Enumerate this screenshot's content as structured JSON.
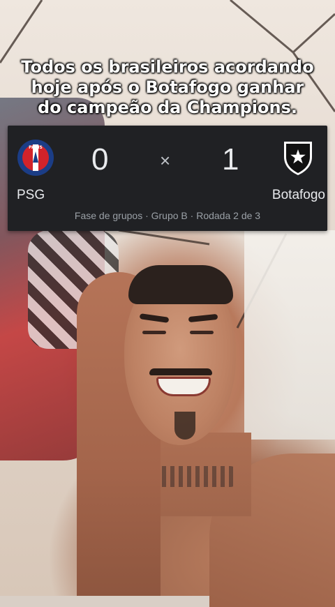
{
  "caption": {
    "line1": "Todos os brasileiros acordando",
    "line2": "hoje após o Botafogo ganhar",
    "line3": "do campeão da Champions."
  },
  "scoreboard": {
    "home_team": "PSG",
    "away_team": "Botafogo",
    "home_score": "0",
    "away_score": "1",
    "separator": "×",
    "round_info": "Fase de grupos · Grupo B · Rodada 2 de 3",
    "psg_logo_text": "PARIS",
    "colors": {
      "card_bg": "#202124",
      "text": "#e8eaed",
      "muted": "#9aa0a6",
      "psg_blue": "#1b3d86",
      "psg_red": "#d2232a"
    }
  }
}
